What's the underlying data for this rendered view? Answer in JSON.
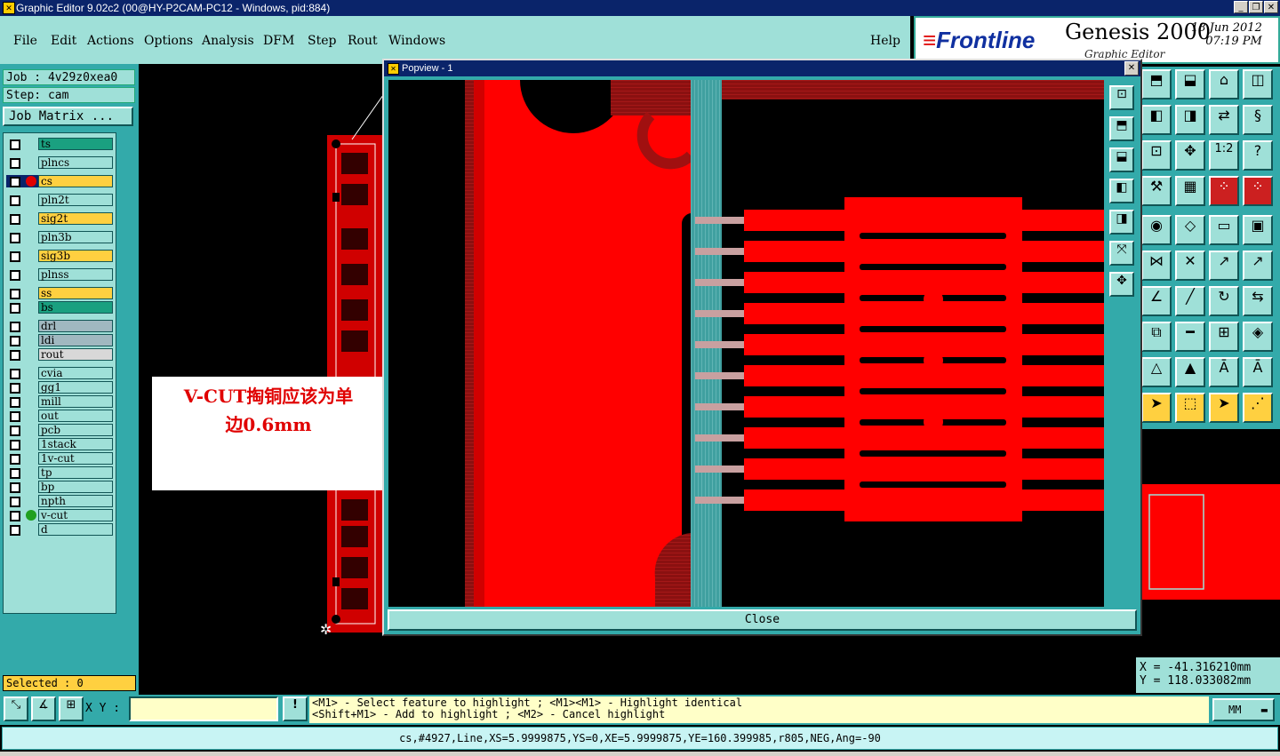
{
  "window": {
    "title": "Graphic Editor 9.02c2 (00@HY-P2CAM-PC12 - Windows, pid:884)"
  },
  "menu": [
    "File",
    "Edit",
    "Actions",
    "Options",
    "Analysis",
    "DFM",
    "Step",
    "Rout",
    "Windows"
  ],
  "help_label": "Help",
  "brand": {
    "logo": "Frontline",
    "product": "Genesis 2000",
    "subtitle": "Graphic Editor",
    "date": "18 Jun 2012",
    "time": "07:19 PM"
  },
  "job": {
    "job_line": "Job : 4v29z0xea0",
    "step_line": "Step: cam",
    "matrix_button": "Job Matrix ..."
  },
  "layers": [
    {
      "name": "ts"
    },
    {
      "name": "plncs"
    },
    {
      "name": "cs"
    },
    {
      "name": "pln2t"
    },
    {
      "name": "sig2t"
    },
    {
      "name": "pln3b"
    },
    {
      "name": "sig3b"
    },
    {
      "name": "plnss"
    },
    {
      "name": "ss"
    },
    {
      "name": "bs"
    },
    {
      "name": "drl"
    },
    {
      "name": "ldi"
    },
    {
      "name": "rout"
    },
    {
      "name": "cvia"
    },
    {
      "name": "gg1"
    },
    {
      "name": "mill"
    },
    {
      "name": "out"
    },
    {
      "name": "pcb"
    },
    {
      "name": "1stack"
    },
    {
      "name": "1v-cut"
    },
    {
      "name": "tp"
    },
    {
      "name": "bp"
    },
    {
      "name": "npth"
    },
    {
      "name": "v-cut"
    },
    {
      "name": "d"
    }
  ],
  "selected_text": "Selected : 0",
  "annotation": {
    "line1": "V-CUT掏铜应该为单",
    "line2": "边0.6mm"
  },
  "popview": {
    "title": "Popview - 1",
    "close_label": "Close"
  },
  "coords": {
    "x": "X = -41.316210mm",
    "y": "Y = 118.033082mm"
  },
  "bottom": {
    "xy_label": "X Y :",
    "xy_value": "",
    "hint1": "<M1> - Select feature to highlight ; <M1><M1> - Highlight identical",
    "hint2": "<Shift+M1> - Add to highlight ; <M2> - Cancel highlight",
    "units": "MM",
    "warn": "!"
  },
  "status": "cs,#4927,Line,XS=5.9999875,YS=0,XE=5.9999875,YE=160.399985,r805,NEG,Ang=-90",
  "colors": {
    "accent": "#9fe0d8",
    "panel": "#33aaaa",
    "copper": "#ff0000",
    "highlight": "#ffd040"
  }
}
